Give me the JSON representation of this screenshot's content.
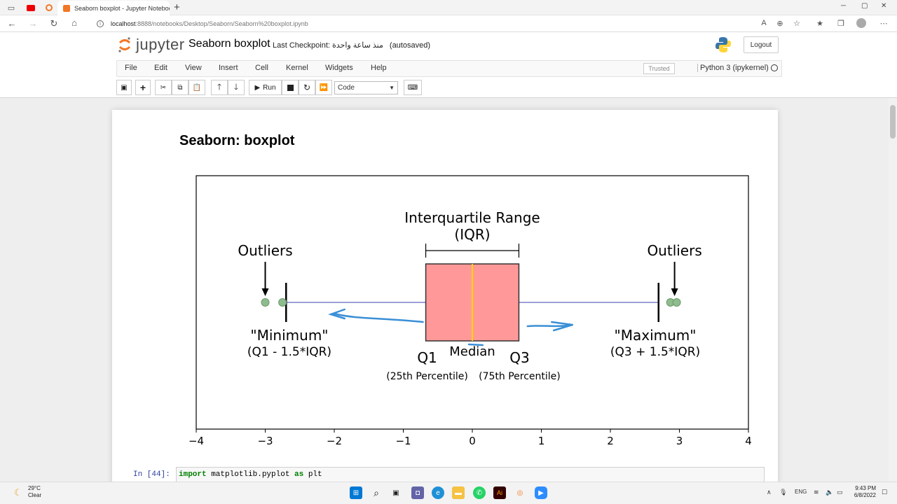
{
  "browser": {
    "tab_title": "Seaborn boxplot - Jupyter Notebook",
    "url_host": "localhost",
    "url_rest": ":8888/notebooks/Desktop/Seaborn/Seaborn%20boxplot.ipynb",
    "new_tab": "+",
    "win_min": "─",
    "win_max": "▢",
    "win_close": "✕"
  },
  "jupyter": {
    "logo_text": "jupyter",
    "notebook_title": "Seaborn boxplot",
    "checkpoint_label": "Last Checkpoint:",
    "checkpoint_time": "منذ ساعة واحدة",
    "autosaved": "(autosaved)",
    "logout": "Logout",
    "menu": [
      "File",
      "Edit",
      "View",
      "Insert",
      "Cell",
      "Kernel",
      "Widgets",
      "Help"
    ],
    "trusted": "Trusted",
    "kernel": "Python 3 (ipykernel)",
    "run_label": "Run",
    "cell_type": "Code"
  },
  "notebook": {
    "heading": "Seaborn: boxplot",
    "prompt": "In [44]:",
    "code_kw1": "import",
    "code_mod": " matplotlib.pyplot ",
    "code_kw2": "as",
    "code_alias": " plt"
  },
  "chart_data": {
    "type": "box",
    "xlim": [
      -4,
      4
    ],
    "xticks": [
      "−4",
      "−3",
      "−2",
      "−1",
      "0",
      "1",
      "2",
      "3",
      "4"
    ],
    "tick_values": [
      -4,
      -3,
      -2,
      -1,
      0,
      1,
      2,
      3,
      4
    ],
    "box": {
      "q1": -0.6745,
      "median": 0,
      "q3": 0.6745,
      "whisker_low": -2.698,
      "whisker_high": 2.698
    },
    "outliers_left": [
      -3.0,
      -2.75
    ],
    "outliers_right": [
      2.87,
      2.96
    ],
    "box_color": "#ff9999",
    "median_color": "#ffd700",
    "whisker_color": "#9d9fd8",
    "outlier_color": "#8fbc8f",
    "annotations": {
      "iqr_line1": "Interquartile Range",
      "iqr_line2": "(IQR)",
      "outliers": "Outliers",
      "minimum": "\"Minimum\"",
      "minimum_formula": "(Q1 - 1.5*IQR)",
      "maximum": "\"Maximum\"",
      "maximum_formula": "(Q3 + 1.5*IQR)",
      "q1": "Q1",
      "q1_sub": "(25th Percentile)",
      "median": "Median",
      "q3": "Q3",
      "q3_sub": "(75th Percentile)"
    }
  },
  "taskbar": {
    "temp": "29°C",
    "condition": "Clear",
    "lang": "ENG",
    "time": "9:43 PM",
    "date": "6/8/2022"
  }
}
